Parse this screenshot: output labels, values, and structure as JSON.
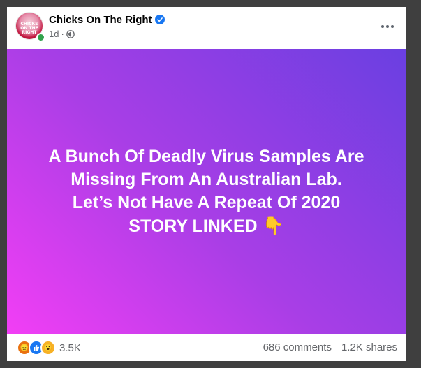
{
  "post": {
    "page_name": "Chicks On The Right",
    "avatar_text": "CHICKS ON THE RIGHT",
    "time": "1d",
    "lines": [
      "A Bunch Of Deadly Virus Samples Are",
      "Missing From An Australian Lab.",
      "Let’s Not Have A Repeat Of 2020",
      "STORY LINKED"
    ],
    "emoji": "👇",
    "background_gradient": [
      "#f23ef5",
      "#6a3fe1"
    ]
  },
  "footer": {
    "reaction_count": "3.5K",
    "comments": "686 comments",
    "shares": "1.2K shares",
    "reaction_icons": [
      "angry-reaction-icon",
      "like-reaction-icon",
      "wow-reaction-icon"
    ]
  }
}
